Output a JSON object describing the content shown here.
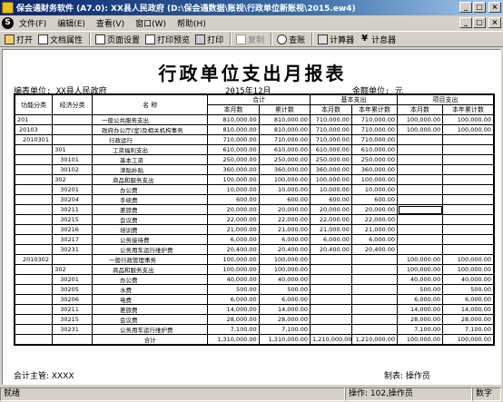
{
  "window": {
    "title": "保会通财务软件 (A7.0): XX县人民政府 (D:\\保会通数据\\账视\\行政单位新账视\\2015.ew4)"
  },
  "menu": {
    "items": [
      "文件(F)",
      "编辑(E)",
      "查看(V)",
      "窗口(W)",
      "帮助(H)"
    ]
  },
  "toolbar": {
    "open": "打开",
    "props": "文档属性",
    "page_setup": "页面设置",
    "preview": "打印预览",
    "print": "打印",
    "copy": "复制",
    "find": "查账",
    "calc": "计算器",
    "calc2": "计息器"
  },
  "report": {
    "title": "行政单位支出月报表",
    "unit_label": "编表单位: XX县人民政府",
    "period": "2015年12月",
    "currency": "金额单位: 元",
    "head": {
      "func": "功能分类",
      "econ": "经济分类",
      "name": "名 称",
      "total": "合计",
      "basic": "基本支出",
      "project": "项目支出",
      "month": "本月数",
      "cum": "累计数",
      "month2": "本月数",
      "cum2": "本年累计数",
      "month3": "本月数",
      "cum3": "本年累计数"
    },
    "rows": [
      {
        "f": "201",
        "e": "",
        "n": "一般公共服务支出",
        "m": "810,000.00",
        "c": "810,000.00",
        "bm": "710,000.00",
        "bc": "710,000.00",
        "pm": "100,000.00",
        "pc": "100,000.00"
      },
      {
        "f": "20103",
        "e": "",
        "n": "政府办公厅(室)及相关机构事务",
        "m": "810,000.00",
        "c": "810,000.00",
        "bm": "710,000.00",
        "bc": "710,000.00",
        "pm": "100,000.00",
        "pc": "100,000.00"
      },
      {
        "f": "2010301",
        "e": "",
        "n": "行政运行",
        "m": "710,000.00",
        "c": "710,000.00",
        "bm": "710,000.00",
        "bc": "710,000.00",
        "pm": "",
        "pc": ""
      },
      {
        "f": "",
        "e": "301",
        "n": "工资福利支出",
        "m": "610,000.00",
        "c": "610,000.00",
        "bm": "610,000.00",
        "bc": "610,000.00",
        "pm": "",
        "pc": ""
      },
      {
        "f": "",
        "e": "30101",
        "n": "基本工资",
        "m": "250,000.00",
        "c": "250,000.00",
        "bm": "250,000.00",
        "bc": "250,000.00",
        "pm": "",
        "pc": ""
      },
      {
        "f": "",
        "e": "30102",
        "n": "津贴补贴",
        "m": "360,000.00",
        "c": "360,000.00",
        "bm": "360,000.00",
        "bc": "360,000.00",
        "pm": "",
        "pc": ""
      },
      {
        "f": "",
        "e": "302",
        "n": "商品和服务支出",
        "m": "100,000.00",
        "c": "100,000.00",
        "bm": "100,000.00",
        "bc": "100,000.00",
        "pm": "",
        "pc": ""
      },
      {
        "f": "",
        "e": "30201",
        "n": "办公费",
        "m": "10,000.00",
        "c": "10,000.00",
        "bm": "10,000.00",
        "bc": "10,000.00",
        "pm": "",
        "pc": ""
      },
      {
        "f": "",
        "e": "30204",
        "n": "手续费",
        "m": "600.00",
        "c": "600.00",
        "bm": "600.00",
        "bc": "600.00",
        "pm": "",
        "pc": ""
      },
      {
        "f": "",
        "e": "30211",
        "n": "差旅费",
        "m": "20,000.00",
        "c": "20,000.00",
        "bm": "20,000.00",
        "bc": "20,000.00",
        "pm": "",
        "pc": "",
        "sel": true
      },
      {
        "f": "",
        "e": "30215",
        "n": "会议费",
        "m": "22,000.00",
        "c": "22,000.00",
        "bm": "22,000.00",
        "bc": "22,000.00",
        "pm": "",
        "pc": ""
      },
      {
        "f": "",
        "e": "30216",
        "n": "培训费",
        "m": "21,000.00",
        "c": "21,000.00",
        "bm": "21,000.00",
        "bc": "21,000.00",
        "pm": "",
        "pc": ""
      },
      {
        "f": "",
        "e": "30217",
        "n": "公务接待费",
        "m": "6,000.00",
        "c": "6,000.00",
        "bm": "6,000.00",
        "bc": "6,000.00",
        "pm": "",
        "pc": ""
      },
      {
        "f": "",
        "e": "30231",
        "n": "公务用车运行维护费",
        "m": "20,400.00",
        "c": "20,400.00",
        "bm": "20,400.00",
        "bc": "20,400.00",
        "pm": "",
        "pc": ""
      },
      {
        "f": "2010302",
        "e": "",
        "n": "一般行政管理事务",
        "m": "100,000.00",
        "c": "100,000.00",
        "bm": "",
        "bc": "",
        "pm": "100,000.00",
        "pc": "100,000.00"
      },
      {
        "f": "",
        "e": "302",
        "n": "商品和服务支出",
        "m": "100,000.00",
        "c": "100,000.00",
        "bm": "",
        "bc": "",
        "pm": "100,000.00",
        "pc": "100,000.00"
      },
      {
        "f": "",
        "e": "30201",
        "n": "办公费",
        "m": "40,000.00",
        "c": "40,000.00",
        "bm": "",
        "bc": "",
        "pm": "40,000.00",
        "pc": "40,000.00"
      },
      {
        "f": "",
        "e": "30205",
        "n": "水费",
        "m": "500.00",
        "c": "500.00",
        "bm": "",
        "bc": "",
        "pm": "500.00",
        "pc": "500.00"
      },
      {
        "f": "",
        "e": "30206",
        "n": "电费",
        "m": "6,000.00",
        "c": "6,000.00",
        "bm": "",
        "bc": "",
        "pm": "6,000.00",
        "pc": "6,000.00"
      },
      {
        "f": "",
        "e": "30211",
        "n": "差旅费",
        "m": "14,000.00",
        "c": "14,000.00",
        "bm": "",
        "bc": "",
        "pm": "14,000.00",
        "pc": "14,000.00"
      },
      {
        "f": "",
        "e": "30215",
        "n": "会议费",
        "m": "28,000.00",
        "c": "28,000.00",
        "bm": "",
        "bc": "",
        "pm": "28,000.00",
        "pc": "28,000.00"
      },
      {
        "f": "",
        "e": "30231",
        "n": "公务用车运行维护费",
        "m": "7,100.00",
        "c": "7,100.00",
        "bm": "",
        "bc": "",
        "pm": "7,100.00",
        "pc": "7,100.00"
      }
    ],
    "total_row": {
      "n": "合计",
      "m": "1,310,000.00",
      "c": "1,310,000.00",
      "bm": "1,210,000.00",
      "bc": "1,210,000.00",
      "pm": "100,000.00",
      "pc": "100,000.00"
    },
    "supervisor": "会计主管: XXXX",
    "preparer": "制表: 操作员"
  },
  "status": {
    "ready": "就绪",
    "operator": "操作: 102,操作员",
    "mode": "数字"
  }
}
